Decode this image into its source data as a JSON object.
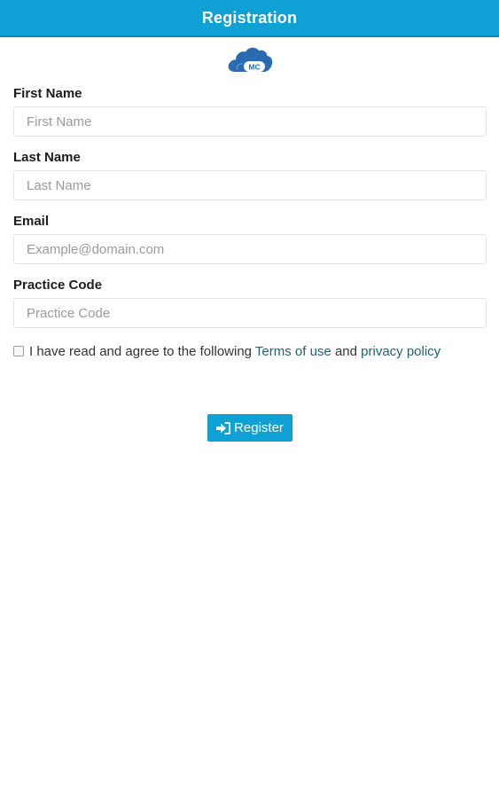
{
  "header": {
    "title": "Registration"
  },
  "logo": {
    "text": "MC",
    "icon": "cloud-logo-icon",
    "color": "#2a6ab0"
  },
  "form": {
    "fields": [
      {
        "label": "First Name",
        "placeholder": "First Name",
        "value": ""
      },
      {
        "label": "Last Name",
        "placeholder": "Last Name",
        "value": ""
      },
      {
        "label": "Email",
        "placeholder": "Example@domain.com",
        "value": ""
      },
      {
        "label": "Practice Code",
        "placeholder": "Practice Code",
        "value": ""
      }
    ]
  },
  "agreement": {
    "checked": false,
    "text_before": "I have read and agree to the following ",
    "terms_link": "Terms of use",
    "text_middle": " and ",
    "privacy_link": "privacy policy"
  },
  "register_button": {
    "label": "Register",
    "icon": "sign-in-icon"
  },
  "colors": {
    "accent": "#0fa0d6",
    "link": "#246070"
  }
}
